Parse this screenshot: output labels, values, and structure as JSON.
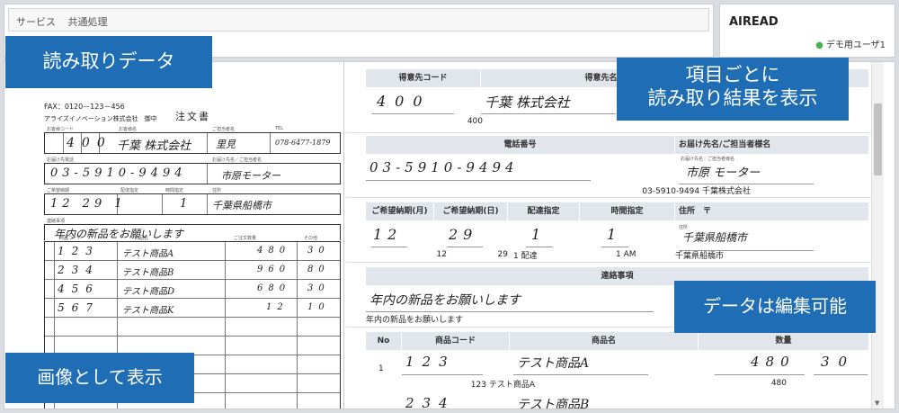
{
  "header": {
    "breadcrumb": [
      "サービス",
      "共通処理"
    ],
    "brand": "AIREAD",
    "user": "デモ用ユーザ1"
  },
  "scan": {
    "fax": "FAX：0120－123－456",
    "company": "アライズイノベーション株式会社　御中",
    "title": "注文書",
    "labels": {
      "customer_code": "お客様コード",
      "customer_name": "お客様名",
      "contact_person": "ご担当者名",
      "tel": "TEL",
      "phone": "お届け先電話",
      "delivery_name": "お届け先名／ご担当者名",
      "delivery_date": "ご希望納期",
      "delivery_spec": "配達指定",
      "time_spec": "時間指定",
      "address": "住所",
      "remarks": "連絡事項",
      "item_code": "商品コード",
      "item_name": "商品名",
      "qty": "ご注文数量",
      "unit": "その他"
    },
    "hw": {
      "code": "400",
      "company": "千葉 株式会社",
      "person": "里見",
      "tel": "078-6477-1879",
      "phone": "03-5910-9494",
      "delivery": "市原モーター",
      "date": "12  29  1",
      "time": "1",
      "address": "千葉県船橋市",
      "remark": "年内の新品をお願いします"
    },
    "items": [
      {
        "code": "123",
        "name": "テスト商品A",
        "qty": "480",
        "unit": "30"
      },
      {
        "code": "234",
        "name": "テスト商品B",
        "qty": "960",
        "unit": "80"
      },
      {
        "code": "456",
        "name": "テスト商品D",
        "qty": "680",
        "unit": "30"
      },
      {
        "code": "567",
        "name": "テスト商品K",
        "qty": "12",
        "unit": "10"
      }
    ]
  },
  "fields": {
    "customer_code_header": "得意先コード",
    "customer_name_header": "得意先名",
    "customer_code_hw": "400",
    "customer_name_hw": "千葉 株式会社",
    "customer_code": "400",
    "phone_header": "電話番号",
    "delivery_header": "お届け先名/ご担当者様名",
    "phone_hw": "03-5910-9494",
    "delivery_label": "お届け先名／ご担当者様名",
    "delivery_hw": "市原 モーター",
    "phone_value": "03-5910-9494 千葉株式会社",
    "month_header": "ご希望納期(月)",
    "day_header": "ご希望納期(日)",
    "spec_header": "配達指定",
    "time_header": "時間指定",
    "address_header": "住所　〒",
    "month_hw": "12",
    "day_hw": "29",
    "spec_hw": "1",
    "time_hw": "1",
    "address_label": "住所",
    "address_hw": "千葉県船橋市",
    "month": "12",
    "day": "29",
    "spec": "1 配達",
    "time": "1 AM",
    "address": "千葉県船橋市",
    "remarks_header": "連絡事項",
    "remarks_hw": "年内の新品をお願いします",
    "remarks": "年内の新品をお願いします",
    "table": {
      "no": "No",
      "code": "商品コード",
      "name": "商品名",
      "qty": "数量",
      "row1": {
        "no": "1",
        "code_hw": "123",
        "name_hw": "テスト商品A",
        "qty_hw": "480",
        "unit_hw": "30",
        "value": "123 テスト商品A",
        "qty": "480",
        "unit": "30"
      },
      "row2": {
        "code_hw": "234",
        "name_hw": "テスト商品B"
      }
    }
  },
  "callouts": {
    "scan": "読み取りデータ",
    "fields": "項目ごとに\n読み取り結果を表示",
    "editable": "データは編集可能",
    "image": "画像として表示"
  },
  "colors": {
    "callout": "#1f6db5",
    "header_cell": "#e1e6ec"
  }
}
